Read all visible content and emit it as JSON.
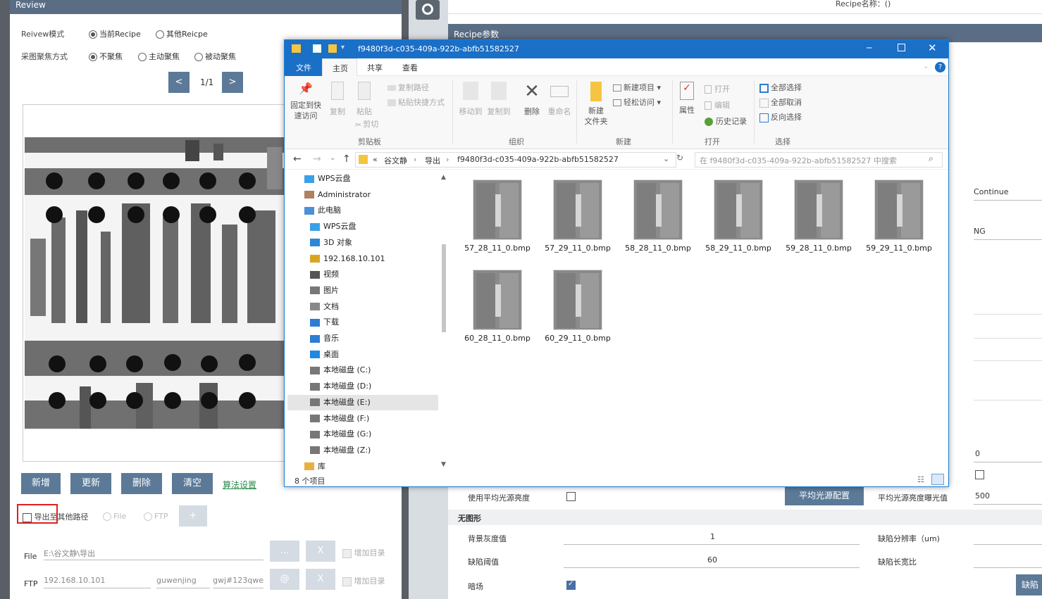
{
  "review": {
    "title": "Review",
    "mode_label": "Reivew模式",
    "mode_options": [
      "当前Recipe",
      "其他Reicpe"
    ],
    "focus_label": "采图聚焦方式",
    "focus_options": [
      "不聚焦",
      "主动聚焦",
      "被动聚焦"
    ],
    "prev": "<",
    "next": ">",
    "page": "1/1",
    "buttons": {
      "add": "新增",
      "update": "更新",
      "delete": "删除",
      "clear": "清空",
      "algo": "算法设置"
    },
    "export_label": "导出至其他路径",
    "export_file": "File",
    "export_ftp": "FTP",
    "plus": "+",
    "file_label": "File",
    "file_path": "E:\\谷文静\\导出",
    "ftp_label": "FTP",
    "ftp_ip": "192.168.10.101",
    "ftp_user": "guwenjing",
    "ftp_pass": "gwj#123qwe",
    "dots": "...",
    "x": "X",
    "at": "@",
    "add_dir": "增加目录"
  },
  "recipe": {
    "name_label": "Recipe名称：()",
    "panel_title": "Recipe参数",
    "continue": "Continue",
    "ng": "NG",
    "val0": "0",
    "val500": "500",
    "avg_light_label": "使用平均光源亮度",
    "avg_light_btn": "平均光源配置",
    "avg_exposure_label": "平均光源亮度曝光值",
    "shapeless": "无图形",
    "bg_gray_label": "背景灰度值",
    "bg_gray": "1",
    "defect_res_label": "缺陷分辨率（um)",
    "defect_thr_label": "缺陷阈值",
    "defect_thr": "60",
    "defect_ratio_label": "缺陷长宽比",
    "darkfield_label": "暗场",
    "side_btn": "缺陷"
  },
  "explorer": {
    "title": "f9480f3d-c035-409a-922b-abfb51582527",
    "tabs": [
      "文件",
      "主页",
      "共享",
      "查看"
    ],
    "ribbon": {
      "pin": "固定到快\n速访问",
      "copy": "复制",
      "paste": "粘贴",
      "copy_path": "复制路径",
      "paste_shortcut": "粘贴快捷方式",
      "cut": "剪切",
      "clipboard": "剪贴板",
      "move_to": "移动到",
      "copy_to": "复制到",
      "delete": "删除",
      "rename": "重命名",
      "organize": "组织",
      "new_folder": "新建\n文件夹",
      "new_item": "新建项目 ▾",
      "easy_access": "轻松访问 ▾",
      "new": "新建",
      "properties": "属性",
      "open": "打开",
      "edit": "编辑",
      "history": "历史记录",
      "open_group": "打开",
      "select_all": "全部选择",
      "select_none": "全部取消",
      "invert": "反向选择",
      "select": "选择"
    },
    "breadcrumb": [
      "«",
      "谷文静",
      "导出",
      "f9480f3d-c035-409a-922b-abfb51582527"
    ],
    "search_placeholder": "在 f9480f3d-c035-409a-922b-abfb51582527 中搜索",
    "nav": [
      {
        "label": "WPS云盘",
        "color": "#3aa0e8"
      },
      {
        "label": "Administrator",
        "color": "#b08060"
      },
      {
        "label": "此电脑",
        "color": "#4a90d9"
      },
      {
        "label": "WPS云盘",
        "color": "#3aa0e8"
      },
      {
        "label": "3D 对象",
        "color": "#2b88d8"
      },
      {
        "label": "192.168.10.101",
        "color": "#d9a520"
      },
      {
        "label": "视频",
        "color": "#555"
      },
      {
        "label": "图片",
        "color": "#777"
      },
      {
        "label": "文档",
        "color": "#888"
      },
      {
        "label": "下载",
        "color": "#2d7dd2"
      },
      {
        "label": "音乐",
        "color": "#2d7dd2"
      },
      {
        "label": "桌面",
        "color": "#1e88e5"
      },
      {
        "label": "本地磁盘 (C:)",
        "color": "#777"
      },
      {
        "label": "本地磁盘 (D:)",
        "color": "#777"
      },
      {
        "label": "本地磁盘 (E:)",
        "color": "#777"
      },
      {
        "label": "本地磁盘 (F:)",
        "color": "#777"
      },
      {
        "label": "本地磁盘 (G:)",
        "color": "#777"
      },
      {
        "label": "本地磁盘 (Z:)",
        "color": "#777"
      },
      {
        "label": "库",
        "color": "#e8b040"
      }
    ],
    "files": [
      "57_28_11_0.bmp",
      "57_29_11_0.bmp",
      "58_28_11_0.bmp",
      "58_29_11_0.bmp",
      "59_28_11_0.bmp",
      "59_29_11_0.bmp",
      "60_28_11_0.bmp",
      "60_29_11_0.bmp"
    ],
    "status": "8 个项目",
    "help": "?"
  }
}
